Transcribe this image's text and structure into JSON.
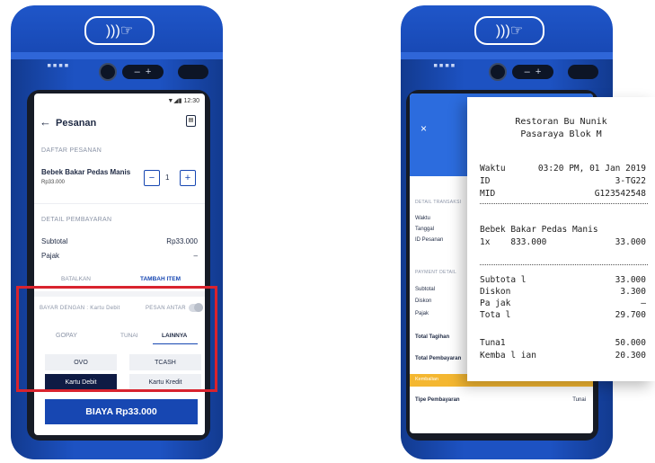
{
  "left_device": {
    "status_time": "12:30",
    "screen_title": "Pesanan",
    "order_section_label": "DAFTAR PESANAN",
    "item_name": "Bebek Bakar Pedas Manis",
    "item_price": "Rp33.000",
    "item_qty": "1",
    "payment_section_label": "DETAIL PEMBAYARAN",
    "subtotal_label": "Subtotal",
    "subtotal_value": "Rp33.000",
    "pajak_label": "Pajak",
    "pajak_value": "–",
    "batalkan_label": "BATALKAN",
    "tambah_item_label": "TAMBAH ITEM",
    "bayar_dengan_label": "BAYAR DENGAN : Kartu Debit",
    "pesan_antar_label": "PESAN ANTAR",
    "pay_tabs": [
      "GOPAY",
      "TUNAI",
      "LAINNYA"
    ],
    "pay_options": [
      "OVO",
      "TCASH",
      "Kartu Debit",
      "Kartu Kredit"
    ],
    "biaya_button": "BIAYA Rp33.000",
    "highlight_color": "#d9232e",
    "accent_color": "#1747b2"
  },
  "right_device": {
    "close_glyph": "×",
    "detail_label": "DETAIL TRANSAKSI",
    "labels": [
      "Waktu",
      "Tanggal",
      "ID Pesanan"
    ],
    "payment_detail_label": "PAYMENT DETAIL",
    "pay_labels": [
      "Subtotal",
      "Diskon",
      "Pajak"
    ],
    "total_tagihan": "Total Tagihan",
    "total_pembayaran": "Total Pembayaran",
    "kembalian_bar": "Kembalian",
    "tipe_pembayaran_label": "Tipe Pembayaran",
    "tipe_pembayaran_value": "Tunai"
  },
  "receipt": {
    "store_name": "Restoran Bu Nunik",
    "store_location": "Pasaraya Blok M",
    "waktu_label": "Waktu",
    "waktu_value": "03:20 PM, 01 Jan 2019",
    "id_label": "ID",
    "id_value": "3-TG22",
    "mid_label": "MID",
    "mid_value": "G123542548",
    "item_name": "Bebek Bakar Pedas Manis",
    "item_qty": "1x",
    "item_unit_price": "833.000",
    "item_total": "33.000",
    "rows": [
      {
        "label": "Subtota l",
        "value": "33.000"
      },
      {
        "label": "Diskon",
        "value": "3.300"
      },
      {
        "label": "Pa jak",
        "value": "–"
      },
      {
        "label": "Tota l",
        "value": "29.700"
      }
    ],
    "rows2": [
      {
        "label": "Tuna1",
        "value": "50.000"
      },
      {
        "label": "Kemba l ian",
        "value": "20.300"
      }
    ]
  }
}
